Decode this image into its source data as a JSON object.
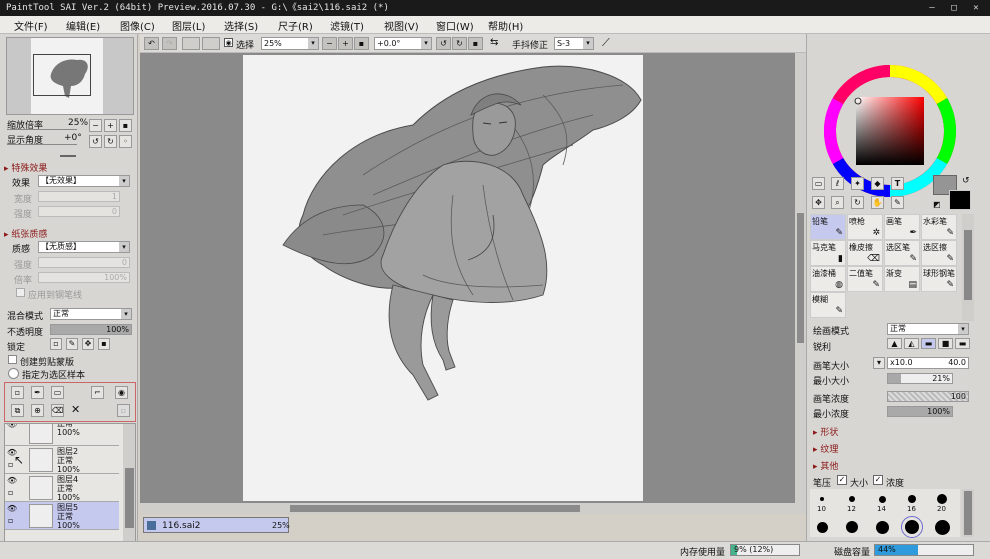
{
  "window": {
    "title": "PaintTool SAI Ver.2 (64bit) Preview.2016.07.30 - G:\\《sai2\\116.sai2 (*)"
  },
  "menu": [
    "文件(F)",
    "编辑(E)",
    "图像(C)",
    "图层(L)",
    "选择(S)",
    "尺子(R)",
    "滤镜(T)",
    "视图(V)",
    "窗口(W)",
    "帮助(H)"
  ],
  "navigator": {
    "zoom_label": "缩放倍率",
    "zoom_value": "25%",
    "angle_label": "显示角度",
    "angle_value": "+0°"
  },
  "effects": {
    "section": "特殊效果",
    "effect_label": "效果",
    "effect_value": "【无效果】",
    "width_label": "宽度",
    "width_value": "1",
    "strength_label": "强度",
    "strength_value": "0"
  },
  "paper": {
    "section": "纸张质感",
    "texture_label": "质感",
    "texture_value": "【无质感】",
    "strength_label": "强度",
    "strength_value": "0",
    "scale_label": "倍率",
    "scale_value": "100%",
    "apply_pen": "应用到钢笔线"
  },
  "layer_props": {
    "blend_label": "混合模式",
    "blend_value": "正常",
    "opacity_label": "不透明度",
    "opacity_value": "100%",
    "opacity_level": 1.0,
    "lock_label": "锁定",
    "clip_label": "创建剪贴蒙版",
    "sample_label": "指定为选区样本"
  },
  "layers": [
    {
      "name": "正常",
      "mode": "100%",
      "partial": true
    },
    {
      "name": "图层2",
      "mode": "正常",
      "opacity": "100%"
    },
    {
      "name": "图层4",
      "mode": "正常",
      "opacity": "100%"
    },
    {
      "name": "图层5",
      "mode": "正常",
      "opacity": "100%",
      "selected": true
    }
  ],
  "toolbar": {
    "select_label": "选择",
    "zoom_value": "25%",
    "angle_value": "+0.0°",
    "stabilizer_label": "手抖修正",
    "stabilizer_value": "S-3"
  },
  "document_tab": {
    "name": "116.sai2",
    "zoom": "25%"
  },
  "brush_tools": [
    {
      "name": "铅笔",
      "selected": true
    },
    {
      "name": "喷枪"
    },
    {
      "name": "画笔"
    },
    {
      "name": "水彩笔"
    },
    {
      "name": "马克笔"
    },
    {
      "name": "橡皮擦"
    },
    {
      "name": "选区笔"
    },
    {
      "name": "选区擦"
    },
    {
      "name": "油漆桶"
    },
    {
      "name": "二值笔"
    },
    {
      "name": "渐变"
    },
    {
      "name": "球形钢笔"
    },
    {
      "name": "模糊"
    }
  ],
  "brush_settings": {
    "mode_label": "绘画模式",
    "mode_value": "正常",
    "edge_label": "锐利",
    "size_label": "画笔大小",
    "size_mult": "x10.0",
    "size_value": "40.0",
    "min_size_label": "最小大小",
    "min_size_value": "21%",
    "min_size_level": 0.21,
    "density_label": "画笔浓度",
    "density_value": "100",
    "min_density_label": "最小浓度",
    "min_density_value": "100%",
    "shape_label": "形状",
    "texture_label": "纹理",
    "other_label": "其他",
    "pressure_label": "笔压",
    "pressure_size": "大小",
    "pressure_density": "浓度"
  },
  "brush_sizes": [
    "10",
    "12",
    "14",
    "16",
    "20"
  ],
  "status": {
    "memory_label": "内存使用量",
    "memory_value": "9% (12%)",
    "memory_level": 0.09,
    "disk_label": "磁盘容量",
    "disk_value": "44%",
    "disk_level": 0.44
  },
  "colors": {
    "accent_red": "#8b1a1a",
    "selected_layer": "#c6c9ee",
    "primary_color": "#959595",
    "secondary_color": "#000000"
  }
}
